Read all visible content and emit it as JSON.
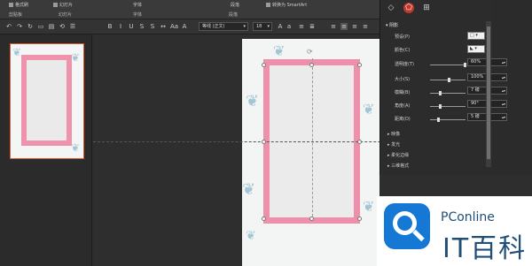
{
  "ribbon": {
    "groups": [
      {
        "label": "格式刷"
      },
      {
        "label": "幻灯片"
      },
      {
        "label": "字体"
      },
      {
        "label": "段落"
      },
      {
        "label": "转换为 SmartArt"
      }
    ],
    "bottom_labels": [
      "剪贴板",
      "幻灯片",
      "字体",
      "段落"
    ]
  },
  "toolbar": {
    "font_name": "等线 (正文)",
    "font_size": "18"
  },
  "format_pane": {
    "section_title": "阴影",
    "preset_label": "预设(P)",
    "color_label": "颜色(C)",
    "properties": [
      {
        "label": "透明度(T)",
        "value": "60%",
        "fraction": 0.6
      },
      {
        "label": "大小(S)",
        "value": "100%",
        "fraction": 0.5
      },
      {
        "label": "模糊(B)",
        "value": "7 磅",
        "fraction": 0.25
      },
      {
        "label": "角度(A)",
        "value": "90°",
        "fraction": 0.25
      },
      {
        "label": "距离(D)",
        "value": "5 磅",
        "fraction": 0.2
      }
    ],
    "collapsed_sections": [
      "映像",
      "发光",
      "柔化边缘",
      "三维格式"
    ]
  },
  "watermark": {
    "brand": "PConline",
    "name": "IT百科"
  },
  "colors": {
    "frame_pink": "#ee8fab",
    "selection_orange": "#d35a2e",
    "active_tab": "#c0392b",
    "logo_blue": "#1478d4"
  }
}
